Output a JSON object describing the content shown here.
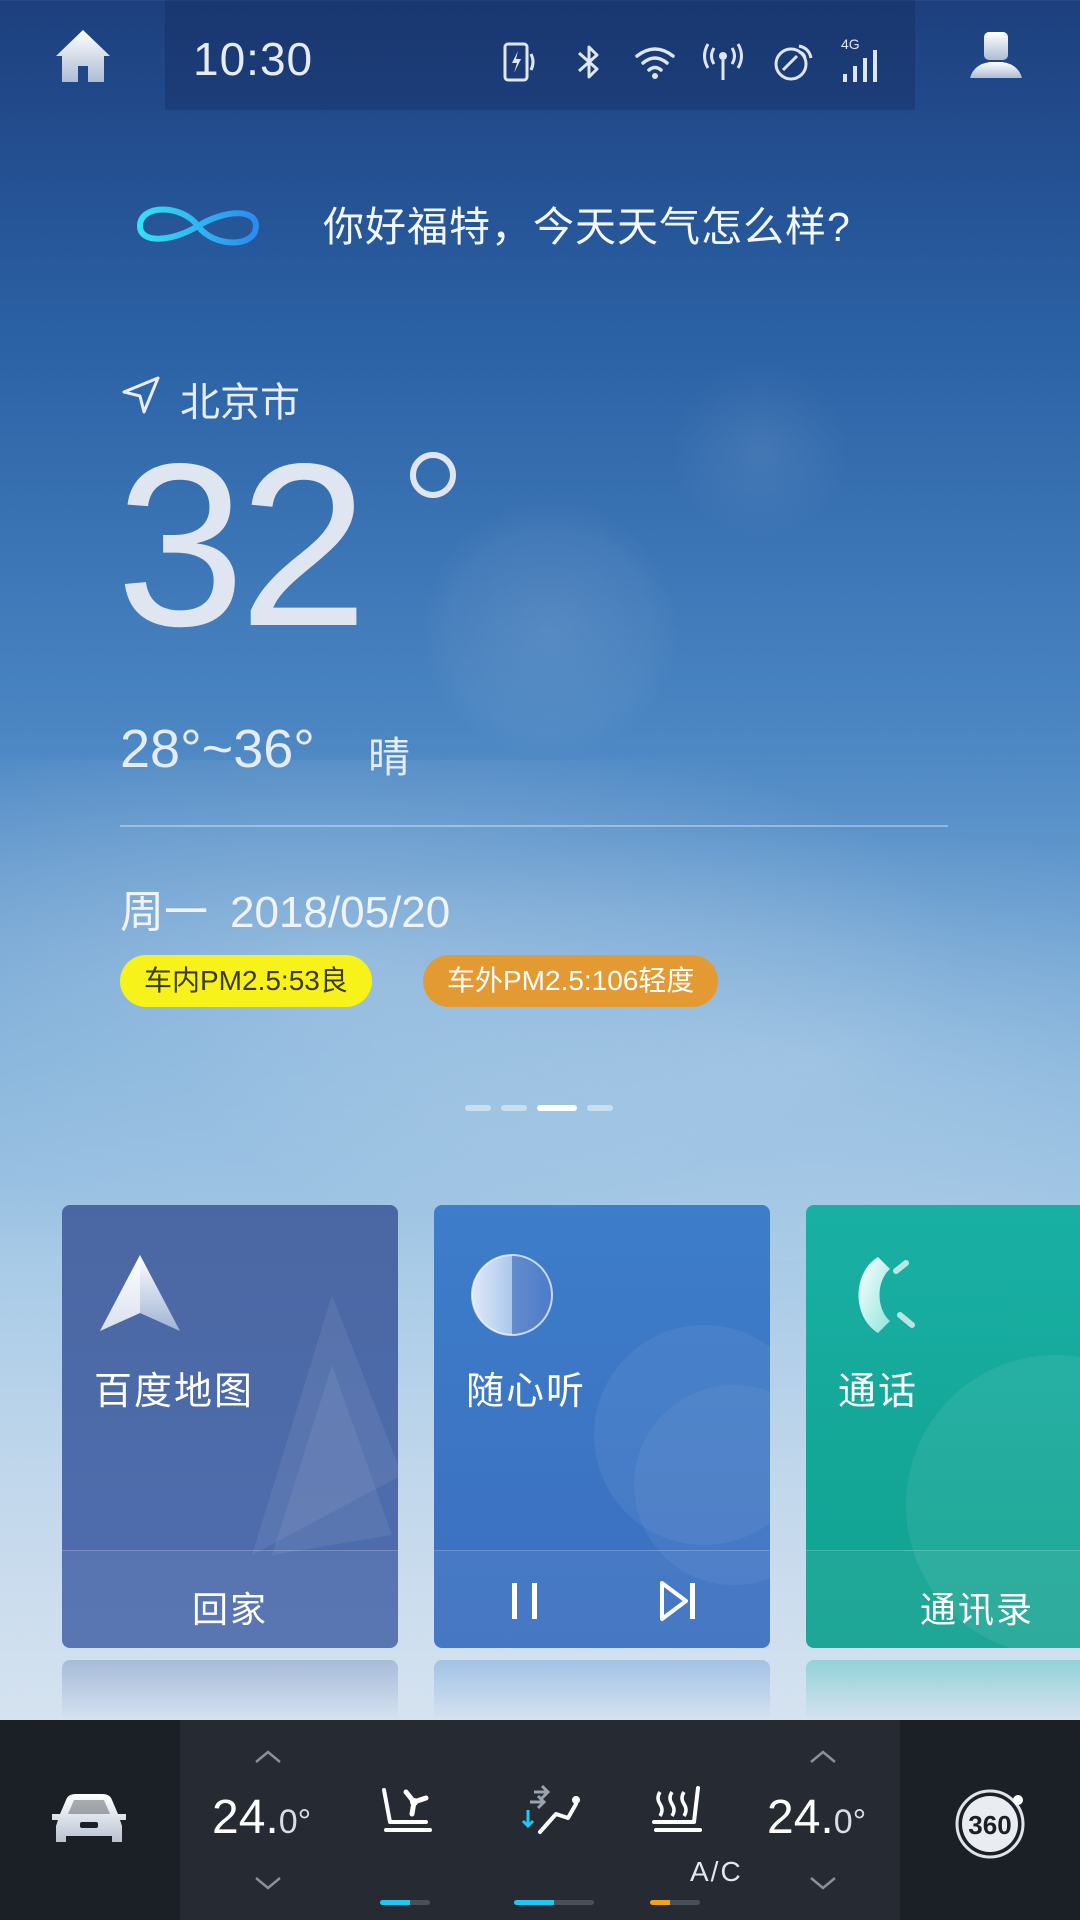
{
  "status_bar": {
    "time": "10:30",
    "icons": [
      "phone-charging-icon",
      "bluetooth-icon",
      "wifi-icon",
      "hotspot-icon",
      "gps-icon",
      "4g-signal-icon"
    ],
    "signal_label": "4G"
  },
  "assistant": {
    "prompt": "你好福特，今天天气怎么样?"
  },
  "weather": {
    "city": "北京市",
    "temperature": "32",
    "range": "28°~36°",
    "condition": "晴",
    "weekday": "周一",
    "date": "2018/05/20",
    "pm_inside": "车内PM2.5:53良",
    "pm_outside": "车外PM2.5:106轻度",
    "colors": {
      "pm_inside": "#f7f21a",
      "pm_outside": "#e39a32"
    }
  },
  "pager": {
    "count": 4,
    "active_index": 2
  },
  "cards": [
    {
      "id": "map",
      "title": "百度地图",
      "footer": "回家",
      "icon": "navigation-arrow-icon"
    },
    {
      "id": "music",
      "title": "随心听",
      "footer_icons": [
        "pause-icon",
        "next-track-icon"
      ],
      "icon": "music-disc-icon"
    },
    {
      "id": "phone",
      "title": "通话",
      "footer": "通讯录",
      "icon": "phone-icon"
    }
  ],
  "climate": {
    "left_temp_int": "24.",
    "left_temp_dec": "0°",
    "right_temp_int": "24.",
    "right_temp_dec": "0°",
    "ac_label": "A/C",
    "seat_fan_level": 0.6,
    "airflow_level": 0.5,
    "seat_heat_level": 0.4,
    "colors": {
      "active": "#22c6f0",
      "heat": "#f0a21a"
    },
    "camera_label": "360"
  }
}
